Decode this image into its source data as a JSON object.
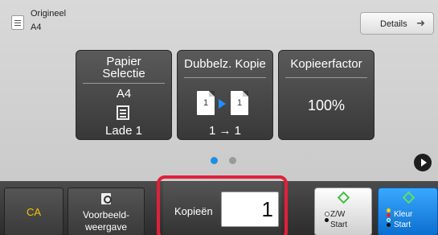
{
  "header": {
    "original_label": "Origineel",
    "original_size": "A4",
    "details_label": "Details"
  },
  "tiles": {
    "paper": {
      "title_line1": "Papier",
      "title_line2": "Selectie",
      "size": "A4",
      "tray": "Lade 1"
    },
    "duplex": {
      "title": "Dubbelz. Kopie",
      "page_left": "1",
      "page_right": "1",
      "mode": "1 → 1"
    },
    "zoom": {
      "title": "Kopieerfactor",
      "value": "100%"
    }
  },
  "pagination": {
    "current": 1,
    "total": 2
  },
  "bottom": {
    "ca_label": "CA",
    "preview_line1": "Voorbeeld-",
    "preview_line2": "weergave",
    "copies_label": "Kopieën",
    "copies_value": "1",
    "bw_line1": "Z/W",
    "bw_line2": "Start",
    "color_line1": "Kleur",
    "color_line2": "Start"
  },
  "colors": {
    "accent_blue": "#1e8fe6",
    "highlight_red": "#e0203a",
    "ca_yellow": "#f5c400",
    "start_green": "#3ec23e"
  },
  "icons": [
    "document-icon",
    "arrow-right-icon",
    "tray-icon",
    "duplex-icon",
    "preview-icon",
    "next-page-icon",
    "start-diamond-icon"
  ]
}
